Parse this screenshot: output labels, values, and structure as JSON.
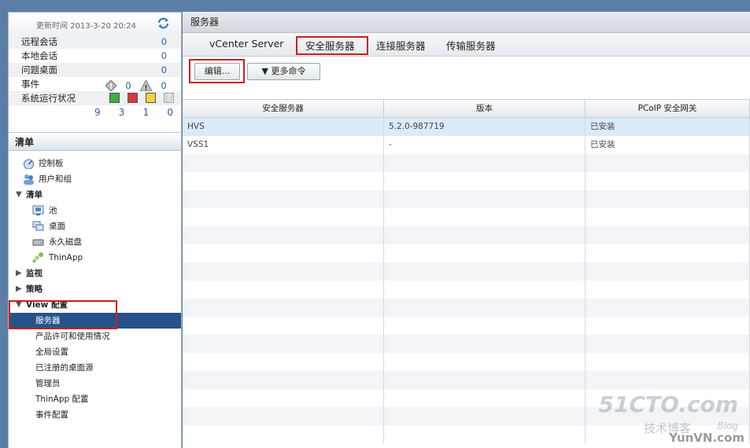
{
  "stats": {
    "update_time": "更新时间 2013-3-20 20:24",
    "remote_sessions": {
      "label": "远程会话",
      "value": "0"
    },
    "local_sessions": {
      "label": "本地会话",
      "value": "0"
    },
    "problem_desktops": {
      "label": "问题桌面",
      "value": "0"
    },
    "events": {
      "label": "事件",
      "error_count": "0",
      "warning_count": "0"
    },
    "system_health": {
      "label": "系统运行状况",
      "counts": [
        "9",
        "3",
        "1",
        "0"
      ]
    }
  },
  "inventory": {
    "title": "清单",
    "items": [
      {
        "label": "控制板",
        "icon": "dashboard-icon"
      },
      {
        "label": "用户和组",
        "icon": "users-icon"
      },
      {
        "label": "清单",
        "section": true
      },
      {
        "label": "池",
        "icon": "pool-icon"
      },
      {
        "label": "桌面",
        "icon": "desktop-icon"
      },
      {
        "label": "永久磁盘",
        "icon": "disk-icon"
      },
      {
        "label": "ThinApp",
        "icon": "thinapp-icon"
      },
      {
        "label": "监视",
        "section": true
      },
      {
        "label": "策略",
        "section": true
      },
      {
        "label": "View 配置",
        "section": true
      },
      {
        "label": "服务器",
        "selected": true
      },
      {
        "label": "产品许可和使用情况"
      },
      {
        "label": "全局设置"
      },
      {
        "label": "已注册的桌面源"
      },
      {
        "label": "管理员"
      },
      {
        "label": "ThinApp 配置"
      },
      {
        "label": "事件配置"
      }
    ]
  },
  "main": {
    "title": "服务器",
    "tabs": [
      "vCenter Server",
      "安全服务器",
      "连接服务器",
      "传输服务器"
    ],
    "active_tab": "安全服务器",
    "toolbar": {
      "edit_label": "编辑...",
      "more_label": "更多命令"
    },
    "table": {
      "columns": [
        "安全服务器",
        "版本",
        "PCoIP 安全网关"
      ],
      "rows": [
        {
          "server": "HVS",
          "version": "5.2.0-987719",
          "pcoip": "已安装"
        },
        {
          "server": "VSS1",
          "version": "-",
          "pcoip": "已安装"
        }
      ]
    }
  },
  "watermark": {
    "line1": "51CTO.com",
    "line2": "技术博客",
    "line3": "Blog",
    "line4": "YunVN.com"
  },
  "colors": {
    "selected_nav": "#25528a",
    "highlight_box": "#cc1f1f",
    "value_blue": "#2a5da8",
    "selected_row": "#dbeaf7"
  }
}
